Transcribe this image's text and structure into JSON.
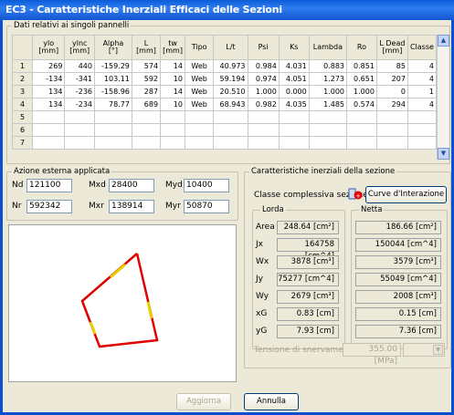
{
  "window": {
    "title": "EC3 - Caratteristiche Inerziali Efficaci delle Sezioni"
  },
  "panels": {
    "group_title": "Dati relativi ai singoli pannelli",
    "columns": [
      "ylo\n[mm]",
      "ylnc\n[mm]",
      "Alpha\n[°]",
      "L\n[mm]",
      "tw\n[mm]",
      "Tipo",
      "L/t",
      "Psi",
      "Ks",
      "Lambda",
      "Ro",
      "L Dead\n[mm]",
      "Classe"
    ],
    "rows": [
      {
        "n": "1",
        "cells": [
          "269",
          "440",
          "-159.29",
          "574",
          "14",
          "Web",
          "40.973",
          "0.984",
          "4.031",
          "0.883",
          "0.851",
          "85",
          "4"
        ]
      },
      {
        "n": "2",
        "cells": [
          "-134",
          "-341",
          "103.11",
          "592",
          "10",
          "Web",
          "59.194",
          "0.974",
          "4.051",
          "1.273",
          "0.651",
          "207",
          "4"
        ]
      },
      {
        "n": "3",
        "cells": [
          "134",
          "-236",
          "-158.96",
          "287",
          "14",
          "Web",
          "20.510",
          "1.000",
          "0.000",
          "1.000",
          "1.000",
          "0",
          "1"
        ]
      },
      {
        "n": "4",
        "cells": [
          "134",
          "-234",
          "78.77",
          "689",
          "10",
          "Web",
          "68.943",
          "0.982",
          "4.035",
          "1.485",
          "0.574",
          "294",
          "4"
        ]
      },
      {
        "n": "5",
        "cells": [
          "",
          "",
          "",
          "",
          "",
          "",
          "",
          "",
          "",
          "",
          "",
          "",
          ""
        ]
      },
      {
        "n": "6",
        "cells": [
          "",
          "",
          "",
          "",
          "",
          "",
          "",
          "",
          "",
          "",
          "",
          "",
          ""
        ]
      },
      {
        "n": "7",
        "cells": [
          "",
          "",
          "",
          "",
          "",
          "",
          "",
          "",
          "",
          "",
          "",
          "",
          ""
        ]
      }
    ]
  },
  "azione": {
    "group_title": "Azione esterna applicata",
    "nd_label": "Nd",
    "nd_value": "121100",
    "mxd_label": "Mxd",
    "mxd_value": "28400",
    "myd_label": "Myd",
    "myd_value": "10400",
    "nr_label": "Nr",
    "nr_value": "592342",
    "mxr_label": "Mxr",
    "mxr_value": "138914",
    "myr_label": "Myr",
    "myr_value": "50870"
  },
  "caratteristiche": {
    "group_title": "Caratteristiche inerziali della sezione",
    "classe_label": "Classe complessiva sezione",
    "curve_button": "Curve d'Interazione",
    "lorda_title": "Lorda",
    "netta_title": "Netta",
    "rows": [
      {
        "label": "Area",
        "lorda": "248.64  [cm²]",
        "netta": "186.66  [cm²]"
      },
      {
        "label": "Jx",
        "lorda": "164758  [cm^4]",
        "netta": "150044  [cm^4]"
      },
      {
        "label": "Wx",
        "lorda": "3878  [cm³]",
        "netta": "3579  [cm³]"
      },
      {
        "label": "Jy",
        "lorda": "75277  [cm^4]",
        "netta": "55049  [cm^4]"
      },
      {
        "label": "Wy",
        "lorda": "2679  [cm³]",
        "netta": "2008  [cm³]"
      },
      {
        "label": "xG",
        "lorda": "0.83  [cm]",
        "netta": "0.15  [cm]"
      },
      {
        "label": "yG",
        "lorda": "7.93  [cm]",
        "netta": "7.36  [cm]"
      }
    ],
    "tensione_label": "Tensione di snervamento",
    "tensione_value": "355.00  [MPa]"
  },
  "buttons": {
    "aggiorna": "Aggiorna",
    "annulla": "Annulla"
  },
  "colors": {
    "section_red": "#e00000",
    "section_yellow": "#e8d000",
    "accent_blue": "#0a5cd8"
  }
}
